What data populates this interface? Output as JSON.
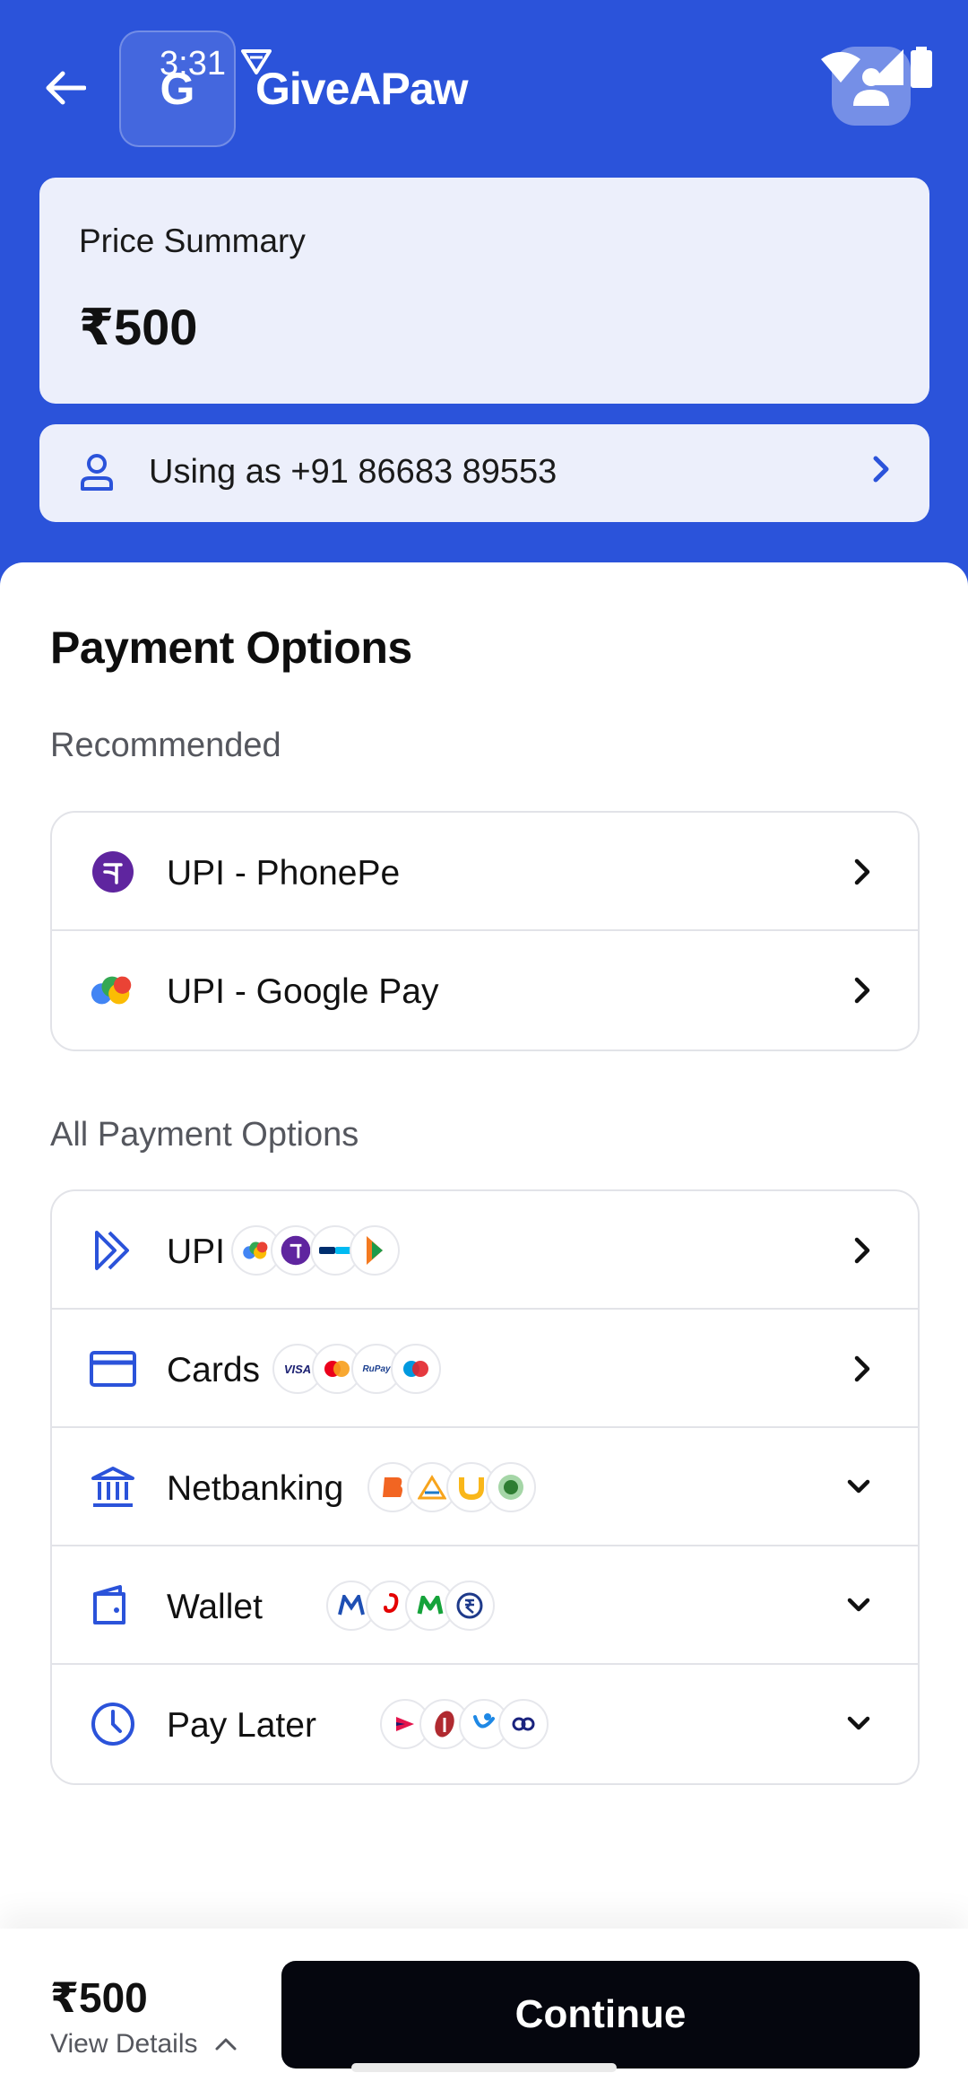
{
  "status_bar": {
    "time": "3:31"
  },
  "header": {
    "back_icon": "arrow-left-icon",
    "logo_letter": "G",
    "brand_name": "GiveAPaw",
    "profile_icon": "user-icon"
  },
  "price_summary": {
    "label": "Price Summary",
    "amount": "₹500"
  },
  "user": {
    "text": "Using as +91 86683 89553",
    "icon": "person-icon"
  },
  "payment": {
    "title": "Payment Options",
    "recommended_label": "Recommended",
    "recommended": [
      {
        "label": "UPI - PhonePe",
        "icon": "phonepe-icon"
      },
      {
        "label": "UPI - Google Pay",
        "icon": "google-pay-icon"
      }
    ],
    "all_label": "All Payment Options",
    "all": [
      {
        "label": "UPI",
        "icon": "upi-icon",
        "chevron": "chevron-right-icon"
      },
      {
        "label": "Cards",
        "icon": "card-icon",
        "chevron": "chevron-right-icon",
        "badges": [
          "VISA",
          "RuPay"
        ]
      },
      {
        "label": "Netbanking",
        "icon": "bank-icon",
        "chevron": "chevron-down-icon"
      },
      {
        "label": "Wallet",
        "icon": "wallet-icon",
        "chevron": "chevron-down-icon"
      },
      {
        "label": "Pay Later",
        "icon": "clock-icon",
        "chevron": "chevron-down-icon"
      }
    ]
  },
  "footer": {
    "amount": "₹500",
    "details_label": "View Details",
    "continue_label": "Continue"
  },
  "colors": {
    "brand_blue": "#2B53DA",
    "card_tint": "#ECEFFB",
    "button_black": "#05060E",
    "phonepe_purple": "#5F259F"
  }
}
